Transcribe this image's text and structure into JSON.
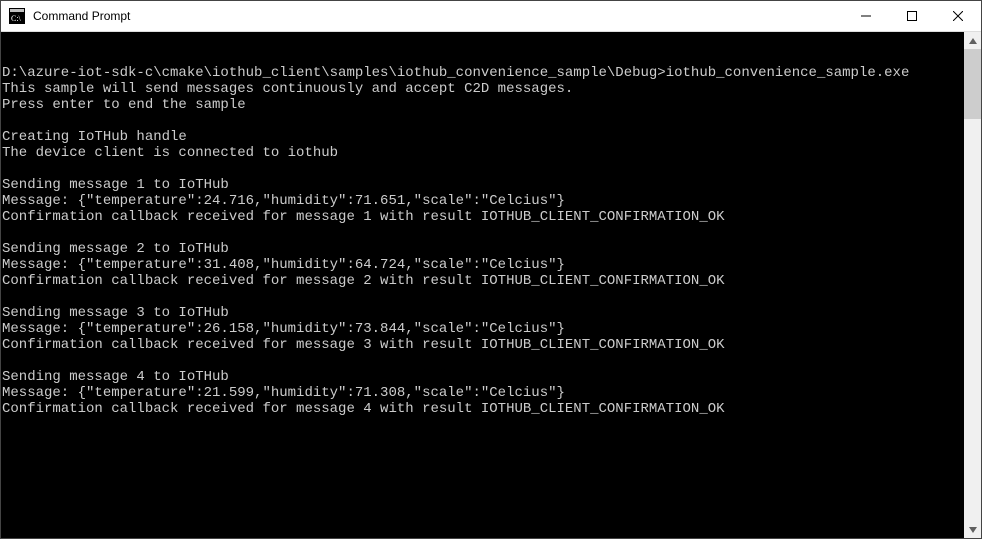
{
  "titlebar": {
    "title": "Command Prompt"
  },
  "terminal": {
    "prompt_path": "D:\\azure-iot-sdk-c\\cmake\\iothub_client\\samples\\iothub_convenience_sample\\Debug>",
    "command": "iothub_convenience_sample.exe",
    "intro_line1": "This sample will send messages continuously and accept C2D messages.",
    "intro_line2": "Press enter to end the sample",
    "status_line1": "Creating IoTHub handle",
    "status_line2": "The device client is connected to iothub",
    "messages": [
      {
        "send": "Sending message 1 to IoTHub",
        "payload": "Message: {\"temperature\":24.716,\"humidity\":71.651,\"scale\":\"Celcius\"}",
        "confirm": "Confirmation callback received for message 1 with result IOTHUB_CLIENT_CONFIRMATION_OK"
      },
      {
        "send": "Sending message 2 to IoTHub",
        "payload": "Message: {\"temperature\":31.408,\"humidity\":64.724,\"scale\":\"Celcius\"}",
        "confirm": "Confirmation callback received for message 2 with result IOTHUB_CLIENT_CONFIRMATION_OK"
      },
      {
        "send": "Sending message 3 to IoTHub",
        "payload": "Message: {\"temperature\":26.158,\"humidity\":73.844,\"scale\":\"Celcius\"}",
        "confirm": "Confirmation callback received for message 3 with result IOTHUB_CLIENT_CONFIRMATION_OK"
      },
      {
        "send": "Sending message 4 to IoTHub",
        "payload": "Message: {\"temperature\":21.599,\"humidity\":71.308,\"scale\":\"Celcius\"}",
        "confirm": "Confirmation callback received for message 4 with result IOTHUB_CLIENT_CONFIRMATION_OK"
      }
    ]
  }
}
